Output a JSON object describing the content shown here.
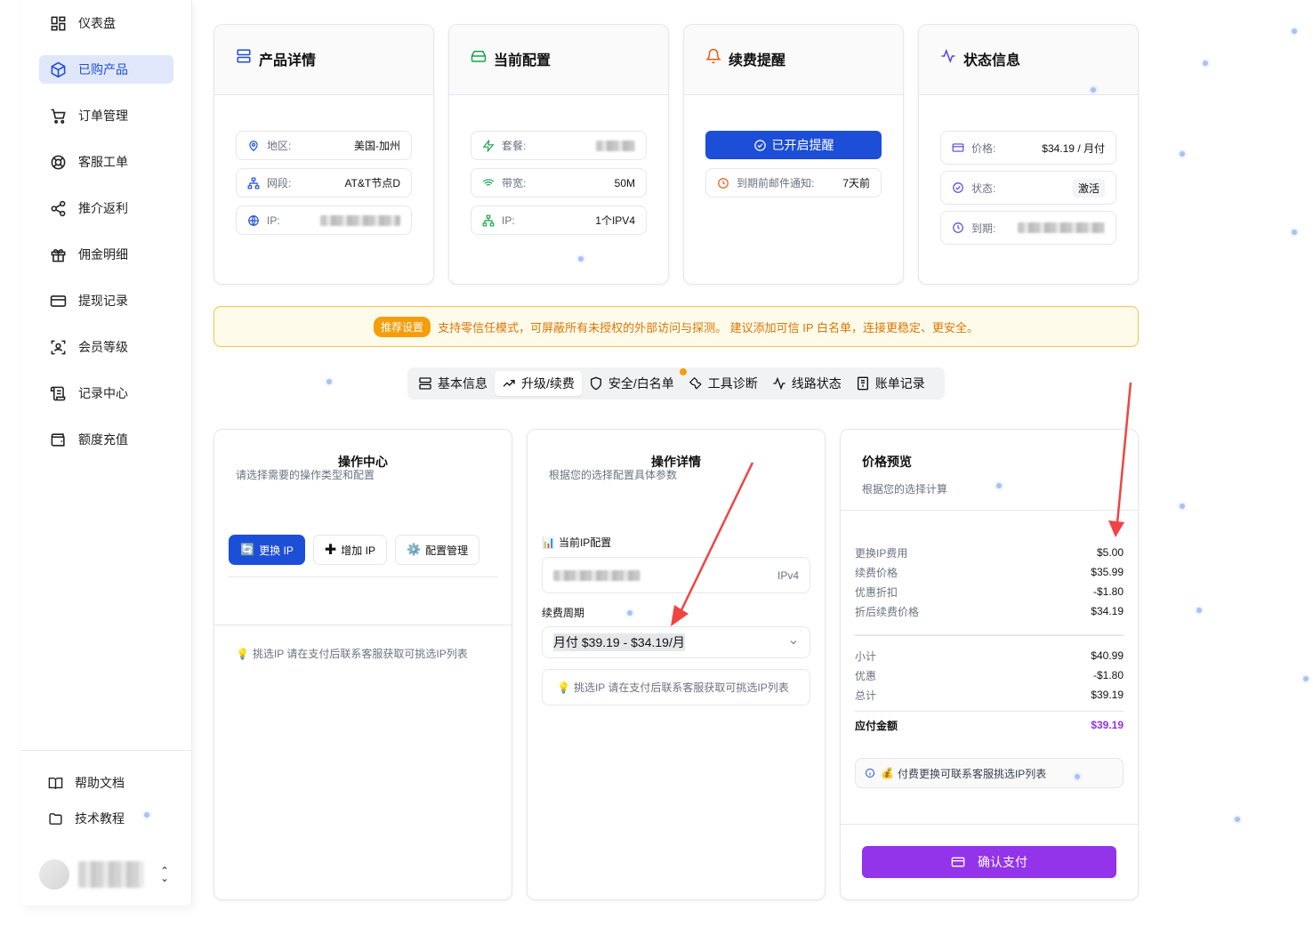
{
  "sidebar": {
    "items": [
      {
        "label": "仪表盘",
        "icon": "dashboard-icon"
      },
      {
        "label": "已购产品",
        "icon": "box-icon"
      },
      {
        "label": "订单管理",
        "icon": "cart-icon"
      },
      {
        "label": "客服工单",
        "icon": "lifebuoy-icon"
      },
      {
        "label": "推介返利",
        "icon": "share-icon"
      },
      {
        "label": "佣金明细",
        "icon": "gift-icon"
      },
      {
        "label": "提现记录",
        "icon": "card-icon"
      },
      {
        "label": "会员等级",
        "icon": "scan-icon"
      },
      {
        "label": "记录中心",
        "icon": "scroll-icon"
      },
      {
        "label": "额度充值",
        "icon": "wallet-icon"
      }
    ],
    "active_index": 1,
    "bottom": [
      {
        "label": "帮助文档",
        "icon": "book-icon"
      },
      {
        "label": "技术教程",
        "icon": "folder-icon"
      }
    ]
  },
  "cards": {
    "product": {
      "title": "产品详情",
      "rows": [
        {
          "label": "地区:",
          "value": "美国-加州"
        },
        {
          "label": "网段:",
          "value": "AT&T节点D"
        },
        {
          "label": "IP:",
          "value": ""
        }
      ]
    },
    "config": {
      "title": "当前配置",
      "rows": [
        {
          "label": "套餐:",
          "value": ""
        },
        {
          "label": "带宽:",
          "value": "50M"
        },
        {
          "label": "IP:",
          "value": "1个IPV4"
        }
      ]
    },
    "renew": {
      "title": "续费提醒",
      "button": "已开启提醒",
      "row_label": "到期前邮件通知:",
      "row_value": "7天前"
    },
    "status": {
      "title": "状态信息",
      "rows": [
        {
          "label": "价格:",
          "value": "$34.19 / 月付"
        },
        {
          "label": "状态:",
          "value": "激活"
        },
        {
          "label": "到期:",
          "value": ""
        }
      ]
    }
  },
  "banner": {
    "badge": "推荐设置",
    "text": "支持零信任模式，可屏蔽所有未授权的外部访问与探测。 建议添加可信 IP 白名单，连接更稳定、更安全。"
  },
  "tabs": [
    {
      "label": "基本信息",
      "icon": "server-icon"
    },
    {
      "label": "升级/续费",
      "icon": "trend-up-icon"
    },
    {
      "label": "安全/白名单",
      "icon": "shield-icon"
    },
    {
      "label": "工具诊断",
      "icon": "wrench-icon"
    },
    {
      "label": "线路状态",
      "icon": "activity-icon"
    },
    {
      "label": "账单记录",
      "icon": "bill-icon"
    }
  ],
  "active_tab": 1,
  "ops": {
    "title": "操作中心",
    "subtitle": "请选择需要的操作类型和配置",
    "buttons": [
      "更换 IP",
      "增加 IP",
      "配置管理"
    ],
    "hint": "挑选IP 请在支付后联系客服获取可挑选IP列表"
  },
  "details": {
    "title": "操作详情",
    "subtitle": "根据您的选择配置具体参数",
    "current_label": "当前IP配置",
    "ip_type": "IPv4",
    "cycle_label": "续费周期",
    "cycle_value": "月付 $39.19 - $34.19/月",
    "hint": "挑选IP 请在支付后联系客服获取可挑选IP列表"
  },
  "price": {
    "title": "价格预览",
    "subtitle": "根据您的选择计算",
    "lines1": [
      {
        "k": "更换IP费用",
        "v": "$5.00"
      },
      {
        "k": "续费价格",
        "v": "$35.99"
      },
      {
        "k": "优惠折扣",
        "v": "-$1.80"
      },
      {
        "k": "折后续费价格",
        "v": "$34.19"
      }
    ],
    "lines2": [
      {
        "k": "小计",
        "v": "$40.99"
      },
      {
        "k": "优惠",
        "v": "-$1.80"
      },
      {
        "k": "总计",
        "v": "$39.19"
      }
    ],
    "due_label": "应付金额",
    "due_value": "$39.19",
    "info": "付费更换可联系客服挑选IP列表",
    "pay_button": "确认支付"
  },
  "colors": {
    "primary": "#1d4ed8",
    "purple": "#9333ea",
    "warning": "#f59e0b",
    "arrow": "#ef4444"
  }
}
